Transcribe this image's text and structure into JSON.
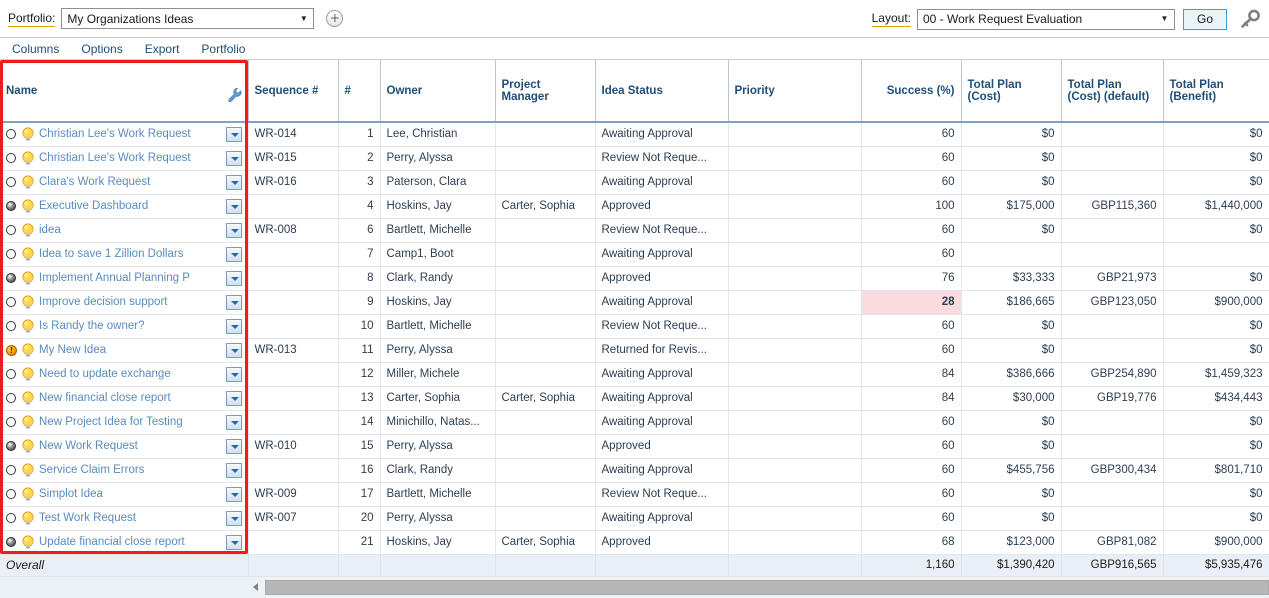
{
  "toolbar": {
    "portfolio_label": "Portfolio:",
    "portfolio_value": "My Organizations Ideas",
    "add_icon": "plus-circle-icon",
    "layout_label": "Layout:",
    "layout_value": "00 - Work Request Evaluation",
    "go_label": "Go",
    "key_icon": "key-icon",
    "dropdown_arrow": "▼"
  },
  "menu": {
    "items": [
      "Columns",
      "Options",
      "Export",
      "Portfolio"
    ]
  },
  "grid": {
    "headers": {
      "name": "Name",
      "name_tool_icon": "wrench-icon",
      "sequence": "Sequence #",
      "index": "#",
      "owner": "Owner",
      "project_manager": "Project\nManager",
      "idea_status": "Idea Status",
      "priority": "Priority",
      "success": "Success (%)",
      "total_plan_cost": "Total Plan\n(Cost)",
      "total_plan_cost_default": "Total Plan\n(Cost) (default)",
      "total_plan_benefit": "Total Plan\n(Benefit)"
    },
    "rows": [
      {
        "marker": "radio",
        "selected": false,
        "icon": "lightbulb-icon",
        "name": "Christian Lee's Work Request",
        "sequence": "WR-014",
        "index": "1",
        "owner": "Lee, Christian",
        "pm": "",
        "status": "Awaiting Approval",
        "priority": "",
        "success": "60",
        "cost": "$0",
        "cost_default": "",
        "benefit": "$0",
        "success_highlight": false
      },
      {
        "marker": "radio",
        "selected": false,
        "icon": "lightbulb-icon",
        "name": "Christian Lee's Work Request",
        "sequence": "WR-015",
        "index": "2",
        "owner": "Perry, Alyssa",
        "pm": "",
        "status": "Review Not Reque...",
        "priority": "",
        "success": "60",
        "cost": "$0",
        "cost_default": "",
        "benefit": "$0",
        "success_highlight": false
      },
      {
        "marker": "radio",
        "selected": false,
        "icon": "lightbulb-icon",
        "name": "Clara's Work Request",
        "sequence": "WR-016",
        "index": "3",
        "owner": "Paterson, Clara",
        "pm": "",
        "status": "Awaiting Approval",
        "priority": "",
        "success": "60",
        "cost": "$0",
        "cost_default": "",
        "benefit": "$0",
        "success_highlight": false
      },
      {
        "marker": "radio",
        "selected": true,
        "icon": "lightbulb-icon",
        "name": "Executive Dashboard",
        "sequence": "",
        "index": "4",
        "owner": "Hoskins, Jay",
        "pm": "Carter, Sophia",
        "status": "Approved",
        "priority": "",
        "success": "100",
        "cost": "$175,000",
        "cost_default": "GBP115,360",
        "benefit": "$1,440,000",
        "success_highlight": false
      },
      {
        "marker": "radio",
        "selected": false,
        "icon": "lightbulb-icon",
        "name": "idea",
        "sequence": "WR-008",
        "index": "6",
        "owner": "Bartlett, Michelle",
        "pm": "",
        "status": "Review Not Reque...",
        "priority": "",
        "success": "60",
        "cost": "$0",
        "cost_default": "",
        "benefit": "$0",
        "success_highlight": false
      },
      {
        "marker": "radio",
        "selected": false,
        "icon": "lightbulb-icon",
        "name": "Idea to save 1 Zillion Dollars",
        "sequence": "",
        "index": "7",
        "owner": "Camp1, Boot",
        "pm": "",
        "status": "Awaiting Approval",
        "priority": "",
        "success": "60",
        "cost": "",
        "cost_default": "",
        "benefit": "",
        "success_highlight": false
      },
      {
        "marker": "radio",
        "selected": true,
        "icon": "lightbulb-icon",
        "name": "Implement Annual Planning P",
        "sequence": "",
        "index": "8",
        "owner": "Clark, Randy",
        "pm": "",
        "status": "Approved",
        "priority": "",
        "success": "76",
        "cost": "$33,333",
        "cost_default": "GBP21,973",
        "benefit": "$0",
        "success_highlight": false
      },
      {
        "marker": "radio",
        "selected": false,
        "icon": "lightbulb-icon",
        "name": "Improve decision support",
        "sequence": "",
        "index": "9",
        "owner": "Hoskins, Jay",
        "pm": "",
        "status": "Awaiting Approval",
        "priority": "",
        "success": "28",
        "cost": "$186,665",
        "cost_default": "GBP123,050",
        "benefit": "$900,000",
        "success_highlight": true
      },
      {
        "marker": "radio",
        "selected": false,
        "icon": "lightbulb-icon",
        "name": "Is Randy the owner?",
        "sequence": "",
        "index": "10",
        "owner": "Bartlett, Michelle",
        "pm": "",
        "status": "Review Not Reque...",
        "priority": "",
        "success": "60",
        "cost": "$0",
        "cost_default": "",
        "benefit": "$0",
        "success_highlight": false
      },
      {
        "marker": "warning",
        "selected": false,
        "icon": "lightbulb-icon",
        "name": "My New Idea",
        "sequence": "WR-013",
        "index": "11",
        "owner": "Perry, Alyssa",
        "pm": "",
        "status": "Returned for Revis...",
        "priority": "",
        "success": "60",
        "cost": "$0",
        "cost_default": "",
        "benefit": "$0",
        "success_highlight": false
      },
      {
        "marker": "radio",
        "selected": false,
        "icon": "lightbulb-icon",
        "name": "Need to update exchange",
        "sequence": "",
        "index": "12",
        "owner": "Miller, Michele",
        "pm": "",
        "status": "Awaiting Approval",
        "priority": "",
        "success": "84",
        "cost": "$386,666",
        "cost_default": "GBP254,890",
        "benefit": "$1,459,323",
        "success_highlight": false
      },
      {
        "marker": "radio",
        "selected": false,
        "icon": "lightbulb-icon",
        "name": "New financial close report",
        "sequence": "",
        "index": "13",
        "owner": "Carter, Sophia",
        "pm": "Carter, Sophia",
        "status": "Awaiting Approval",
        "priority": "",
        "success": "84",
        "cost": "$30,000",
        "cost_default": "GBP19,776",
        "benefit": "$434,443",
        "success_highlight": false
      },
      {
        "marker": "radio",
        "selected": false,
        "icon": "lightbulb-icon",
        "name": "New Project Idea for Testing",
        "sequence": "",
        "index": "14",
        "owner": "Minichillo, Natas...",
        "pm": "",
        "status": "Awaiting Approval",
        "priority": "",
        "success": "60",
        "cost": "$0",
        "cost_default": "",
        "benefit": "$0",
        "success_highlight": false
      },
      {
        "marker": "radio",
        "selected": true,
        "icon": "lightbulb-icon",
        "name": "New Work Request",
        "sequence": "WR-010",
        "index": "15",
        "owner": "Perry, Alyssa",
        "pm": "",
        "status": "Approved",
        "priority": "",
        "success": "60",
        "cost": "$0",
        "cost_default": "",
        "benefit": "$0",
        "success_highlight": false
      },
      {
        "marker": "radio",
        "selected": false,
        "icon": "lightbulb-icon",
        "name": "Service Claim Errors",
        "sequence": "",
        "index": "16",
        "owner": "Clark, Randy",
        "pm": "",
        "status": "Awaiting Approval",
        "priority": "",
        "success": "60",
        "cost": "$455,756",
        "cost_default": "GBP300,434",
        "benefit": "$801,710",
        "success_highlight": false
      },
      {
        "marker": "radio",
        "selected": false,
        "icon": "lightbulb-icon",
        "name": "Simplot Idea",
        "sequence": "WR-009",
        "index": "17",
        "owner": "Bartlett, Michelle",
        "pm": "",
        "status": "Review Not Reque...",
        "priority": "",
        "success": "60",
        "cost": "$0",
        "cost_default": "",
        "benefit": "$0",
        "success_highlight": false
      },
      {
        "marker": "radio",
        "selected": false,
        "icon": "lightbulb-icon",
        "name": "Test Work Request",
        "sequence": "WR-007",
        "index": "20",
        "owner": "Perry, Alyssa",
        "pm": "",
        "status": "Awaiting Approval",
        "priority": "",
        "success": "60",
        "cost": "$0",
        "cost_default": "",
        "benefit": "$0",
        "success_highlight": false
      },
      {
        "marker": "radio",
        "selected": true,
        "icon": "lightbulb-icon",
        "name": "Update financial close report",
        "sequence": "",
        "index": "21",
        "owner": "Hoskins, Jay",
        "pm": "Carter, Sophia",
        "status": "Approved",
        "priority": "",
        "success": "68",
        "cost": "$123,000",
        "cost_default": "GBP81,082",
        "benefit": "$900,000",
        "success_highlight": false
      }
    ],
    "footer": {
      "label": "Overall",
      "success": "1,160",
      "cost": "$1,390,420",
      "cost_default": "GBP916,565",
      "benefit": "$5,935,476"
    }
  },
  "colors": {
    "link": "#5b8bbd",
    "header_text": "#1f4e79",
    "highlight_bg": "#fadcdc",
    "highlight_border": "#d43f3f",
    "selection_box": "#ee1c1c"
  }
}
